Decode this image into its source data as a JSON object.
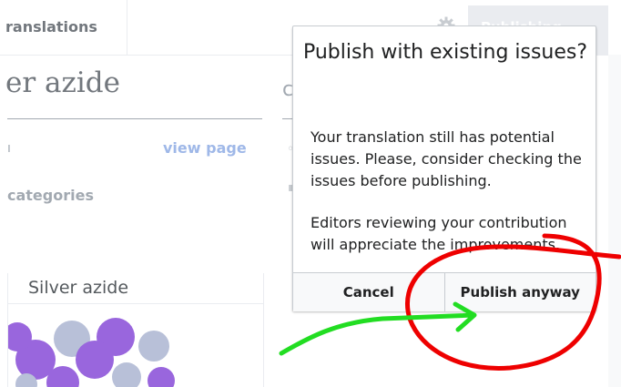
{
  "header": {
    "tab_translations": "ranslations",
    "publish_button": "Publishing"
  },
  "article": {
    "title": "er azide",
    "meta_fragment": "ı",
    "view_page": "view page",
    "categories": "categories",
    "column2_glyph": "c",
    "column2_mark1": "◦",
    "column2_mark2": "▪"
  },
  "infobox": {
    "title": "Silver azide"
  },
  "dialog": {
    "title": "Publish with existing issues?",
    "body_paragraph_1": "Your translation still has potential issues. Please, consider checking the issues before publishing.",
    "body_paragraph_2": "Editors reviewing your contribution will appreciate the improvements.",
    "cancel_label": "Cancel",
    "publish_anyway_label": "Publish anyway"
  },
  "colors": {
    "annotation_circle": "#ee0000",
    "annotation_arrow": "#22dd22",
    "link": "#9fb8e8",
    "atom_purple": "#9966dd",
    "atom_gray": "#b8c0d8"
  },
  "icons": {
    "settings": "gear-icon"
  }
}
